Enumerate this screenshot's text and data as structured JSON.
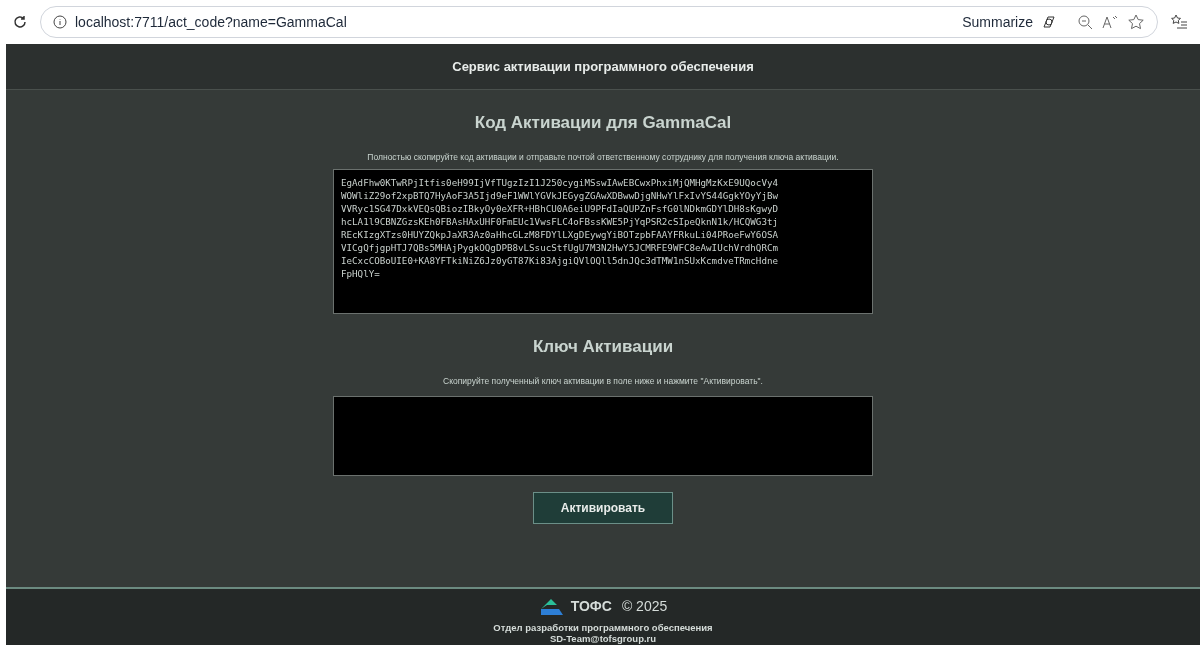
{
  "browser": {
    "url": "localhost:7711/act_code?name=GammaCal",
    "summarize_label": "Summarize"
  },
  "header": {
    "title": "Сервис активации программного обеспечения"
  },
  "activation_code": {
    "title": "Код Активации для GammaCal",
    "instruction": "Полностью скопируйте код активации и отправьте почтой ответственному сотруднику для получения ключа активации.",
    "value": "EgAdFhw0KTwRPjItfis0eH99IjVfTUgzIzI1J250cygiMSswIAwEBCwxPhxiMjQMHgMzKxE9UQocVy4\nWOWliZ29of2xpBTQ7HyAoF3A5Ijd9eF1WWlYGVkJEGygZGAwXDBwwDjgNHwYlFxIvYS44GgkYOyYjBw\nVVRyc1SG47DxkVEQsQBiozIBkyOy0eXFR+HBhCU0A6eiU9PFdIaQUPZnFsfG0lNDkmGDYlDH8sKgwyD\nhcLA1l9CBNZGzsKEh0FBAsHAxUHF0FmEUc1VwsFLC4oFBssKWE5PjYqPSR2cSIpeQknN1k/HCQWG3tj\nREcKIzgXTzs0HUYZQkpJaXR3Az0aHhcGLzM8FDYlLXgDEywgYiBOTzpbFAAYFRkuLi04PRoeFwY6OSA\nVICgQfjgpHTJ7QBs5MHAjPygkOQgDPB8vLSsucStfUgU7M3N2HwY5JCMRFE9WFC8eAwIUchVrdhQRCm\nIeCxcCOBoUIE0+KA8YFTkiNiZ6Jz0yGT87Ki83AjgiQVlOQll5dnJQc3dTMW1nSUxKcmdveTRmcHdne\nFpHQlY="
  },
  "activation_key": {
    "title": "Ключ Активации",
    "instruction": "Скопируйте полученный ключ активации в поле ниже и нажмите \"Активировать\".",
    "button": "Активировать"
  },
  "footer": {
    "brand": "ТОФС",
    "copyright": "© 2025",
    "department": "Отдел разработки программного обеспечения",
    "email": "SD-Team@tofsgroup.ru"
  }
}
